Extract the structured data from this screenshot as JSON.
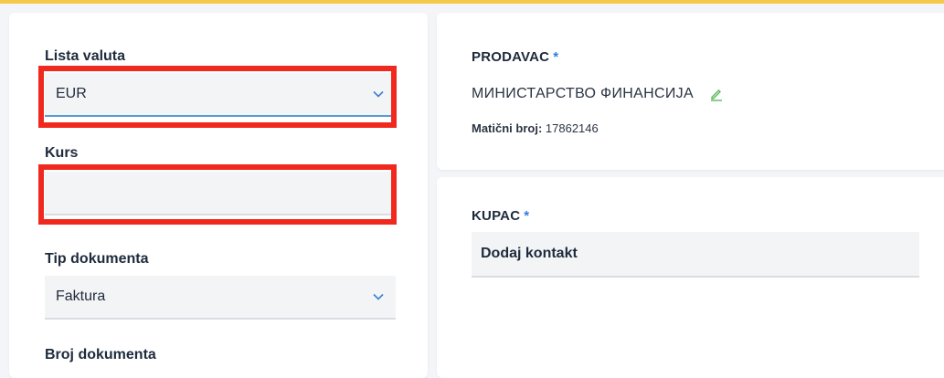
{
  "form": {
    "currency_list": {
      "label": "Lista valuta",
      "value": "EUR"
    },
    "rate": {
      "label": "Kurs",
      "value": ""
    },
    "document_type": {
      "label": "Tip dokumenta",
      "value": "Faktura"
    },
    "document_number": {
      "label": "Broj dokumenta"
    }
  },
  "seller": {
    "title": "PRODAVAC",
    "required_mark": "*",
    "name": "МИНИСТАРСТВО ФИНАНСИЈА",
    "reg_label": "Matični broj:",
    "reg_value": "17862146"
  },
  "buyer": {
    "title": "KUPAC",
    "required_mark": "*",
    "add_contact": "Dodaj kontakt"
  },
  "colors": {
    "accent_blue": "#2f7de1",
    "highlight_red": "#f0291f",
    "top_bar": "#f5c94a",
    "edit_green": "#5cb85c"
  },
  "icons": {
    "select_chevron": "chevron-down-icon",
    "edit": "pencil-icon"
  }
}
